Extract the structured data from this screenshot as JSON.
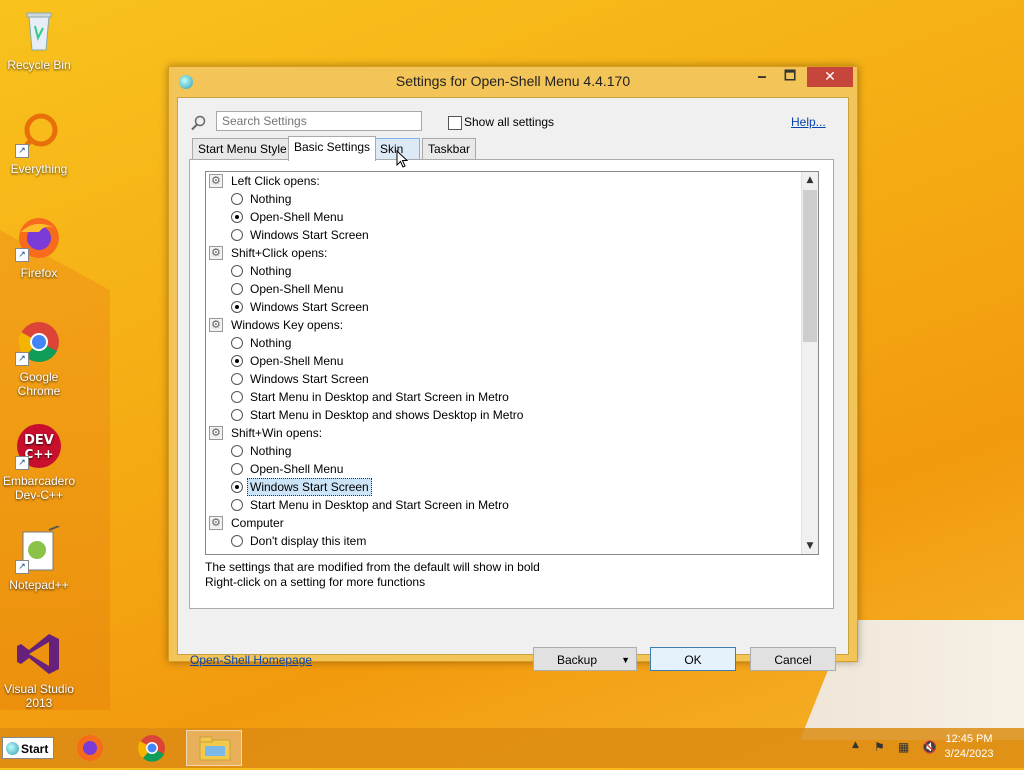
{
  "desktop": {
    "icons": [
      {
        "label": "Recycle Bin"
      },
      {
        "label": "Everything"
      },
      {
        "label": "Firefox"
      },
      {
        "label": "Google Chrome"
      },
      {
        "label": "Embarcadero Dev-C++"
      },
      {
        "label": "Notepad++"
      },
      {
        "label": "Visual Studio 2013"
      }
    ]
  },
  "window": {
    "title": "Settings for Open-Shell Menu 4.4.170",
    "minimize": "🗕",
    "maximize": "🗖",
    "close": "✕"
  },
  "toolbar": {
    "search_placeholder": "Search Settings",
    "show_all_label": "Show all settings",
    "help_label": "Help..."
  },
  "tabs": [
    {
      "label": "Start Menu Style"
    },
    {
      "label": "Basic Settings",
      "active": true
    },
    {
      "label": "Skin"
    },
    {
      "label": "Taskbar"
    }
  ],
  "settings": [
    {
      "type": "group",
      "label": "Left Click opens:"
    },
    {
      "type": "option",
      "label": "Nothing",
      "checked": false
    },
    {
      "type": "option",
      "label": "Open-Shell Menu",
      "checked": true
    },
    {
      "type": "option",
      "label": "Windows Start Screen",
      "checked": false
    },
    {
      "type": "group",
      "label": "Shift+Click opens:"
    },
    {
      "type": "option",
      "label": "Nothing",
      "checked": false
    },
    {
      "type": "option",
      "label": "Open-Shell Menu",
      "checked": false
    },
    {
      "type": "option",
      "label": "Windows Start Screen",
      "checked": true
    },
    {
      "type": "group",
      "label": "Windows Key opens:"
    },
    {
      "type": "option",
      "label": "Nothing",
      "checked": false
    },
    {
      "type": "option",
      "label": "Open-Shell Menu",
      "checked": true
    },
    {
      "type": "option",
      "label": "Windows Start Screen",
      "checked": false
    },
    {
      "type": "option",
      "label": "Start Menu in Desktop and Start Screen in Metro",
      "checked": false
    },
    {
      "type": "option",
      "label": "Start Menu in Desktop and shows Desktop in Metro",
      "checked": false
    },
    {
      "type": "group",
      "label": "Shift+Win opens:"
    },
    {
      "type": "option",
      "label": "Nothing",
      "checked": false
    },
    {
      "type": "option",
      "label": "Open-Shell Menu",
      "checked": false
    },
    {
      "type": "option",
      "label": "Windows Start Screen",
      "checked": true,
      "selected": true
    },
    {
      "type": "option",
      "label": "Start Menu in Desktop and Start Screen in Metro",
      "checked": false
    },
    {
      "type": "group",
      "label": "Computer"
    },
    {
      "type": "option",
      "label": "Don't display this item",
      "checked": false
    }
  ],
  "hints": {
    "line1": "The settings that are modified from the default will show in bold",
    "line2": "Right-click on a setting for more functions"
  },
  "footer": {
    "homepage_label": "Open-Shell Homepage",
    "backup_label": "Backup",
    "ok_label": "OK",
    "cancel_label": "Cancel"
  },
  "taskbar": {
    "start_label": "Start",
    "clock_time": "12:45 PM",
    "clock_date": "3/24/2023"
  },
  "colors": {
    "accent_link": "#0645ad",
    "close_button": "#c7463b",
    "selection": "#cce4f7"
  }
}
